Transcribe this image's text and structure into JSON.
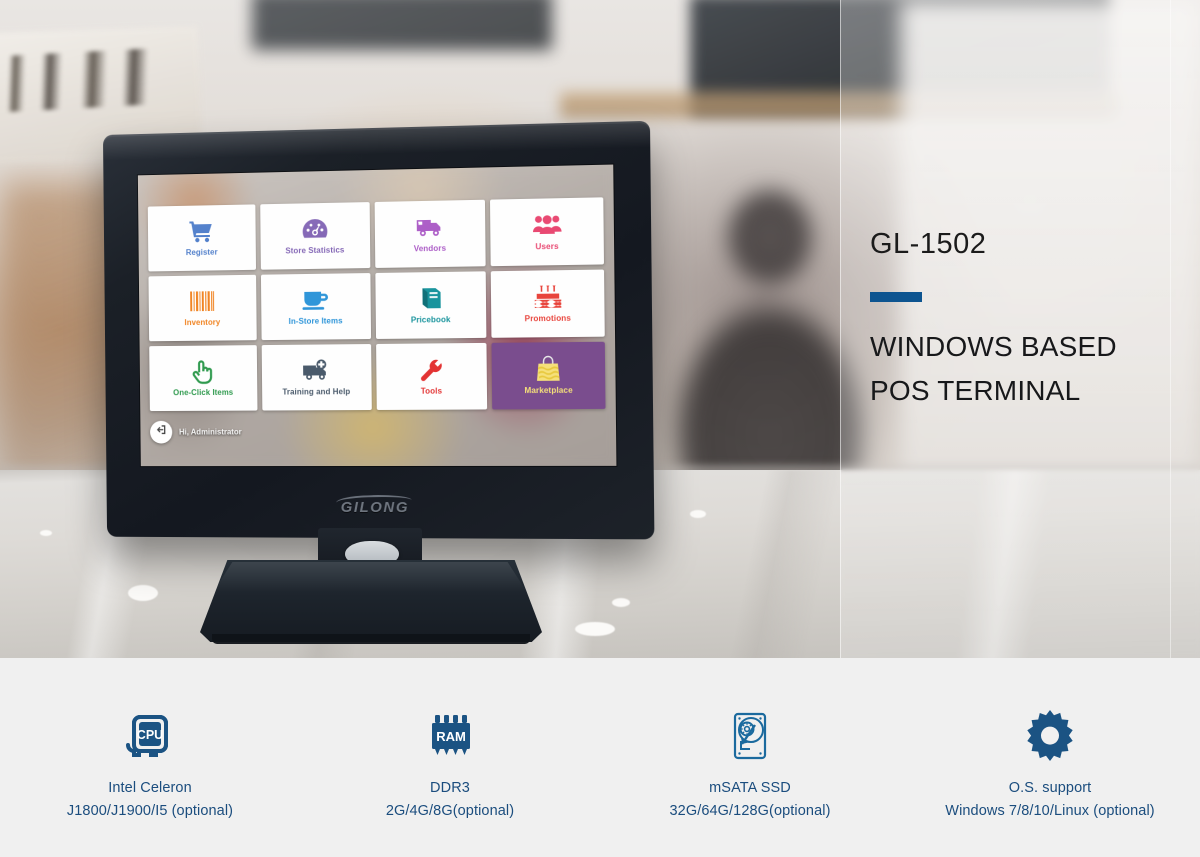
{
  "product": {
    "model": "GL-1502",
    "headline_line1": "WINDOWS BASED",
    "headline_line2": "POS TERMINAL",
    "accent_color": "#0d5490",
    "brand": "GILONG"
  },
  "pos_screen": {
    "tiles": [
      {
        "label": "Register",
        "icon": "shopping-cart-icon",
        "color": "#3b6fc4",
        "bg": "#fefefe"
      },
      {
        "label": "Store Statistics",
        "icon": "gauge-icon",
        "color": "#7a5bb0",
        "bg": "#fefefe"
      },
      {
        "label": "Vendors",
        "icon": "delivery-truck-icon",
        "color": "#a855c4",
        "bg": "#fefefe"
      },
      {
        "label": "Users",
        "icon": "users-group-icon",
        "color": "#e8446e",
        "bg": "#fefefe"
      },
      {
        "label": "Inventory",
        "icon": "barcode-icon",
        "color": "#f07f1a",
        "bg": "#fefefe"
      },
      {
        "label": "In-Store Items",
        "icon": "coffee-cup-icon",
        "color": "#2a93d8",
        "bg": "#fefefe"
      },
      {
        "label": "Pricebook",
        "icon": "book-icon",
        "color": "#17939c",
        "bg": "#fefefe"
      },
      {
        "label": "Promotions",
        "icon": "birthday-cake-icon",
        "color": "#e8443c",
        "bg": "#fefefe"
      },
      {
        "label": "One-Click Items",
        "icon": "pointing-hand-icon",
        "color": "#2f9a4e",
        "bg": "#fefefe"
      },
      {
        "label": "Training and Help",
        "icon": "ambulance-icon",
        "color": "#4a5a6b",
        "bg": "#fefefe"
      },
      {
        "label": "Tools",
        "icon": "wrench-icon",
        "color": "#e33333",
        "bg": "#fefefe"
      },
      {
        "label": "Marketplace",
        "icon": "shopping-bag-icon",
        "color": "#f5e07a",
        "bg": "#7a4d8e"
      }
    ],
    "status": {
      "greeting": "Hi, Administrator",
      "logout_icon": "logout-arrow-icon"
    }
  },
  "specs": [
    {
      "icon": "cpu-chip-icon",
      "title": "Intel Celeron",
      "detail": "J1800/J1900/I5 (optional)"
    },
    {
      "icon": "ram-chip-icon",
      "title": "DDR3",
      "detail": "2G/4G/8G(optional)"
    },
    {
      "icon": "hard-drive-icon",
      "title": "mSATA SSD",
      "detail": "32G/64G/128G(optional)"
    },
    {
      "icon": "gear-icon",
      "title": "O.S. support",
      "detail": "Windows 7/8/10/Linux (optional)"
    }
  ]
}
